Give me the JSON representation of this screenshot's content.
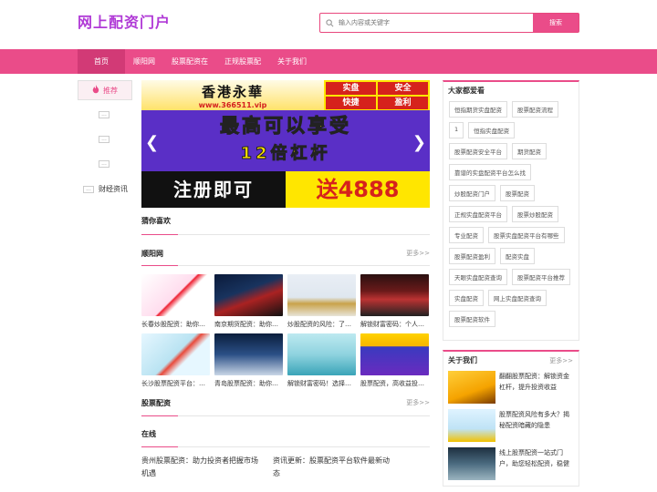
{
  "site": {
    "logo": "网上配资门户"
  },
  "search": {
    "placeholder": "输入内容或关键字",
    "button": "搜索"
  },
  "nav": {
    "items": [
      "首页",
      "顺阳网",
      "股票配资在",
      "正规股票配",
      "关于我们"
    ]
  },
  "left": {
    "recommend": "推荐",
    "dots": [
      "...",
      "...",
      "...",
      "..."
    ],
    "category": "财经资讯"
  },
  "banner": {
    "brand": "香港永華",
    "url": "www.366511.vip",
    "tags": [
      "实盘",
      "安全",
      "快捷",
      "盈利"
    ],
    "line1": "最高可以享受",
    "line2": "12倍杠杆",
    "line3a": "注册即可",
    "line3b": "送4888"
  },
  "sections": {
    "guess": "猜你喜欢",
    "shunyang": "顺阳网",
    "peizi": "股票配资",
    "online": "在线",
    "more": "更多>>"
  },
  "thumbs": [
    {
      "caption": "长春炒股配资：助你…"
    },
    {
      "caption": "南京期货配资：助你…"
    },
    {
      "caption": "炒股配资的风险：了…"
    },
    {
      "caption": "解锁财富密码：个人…"
    },
    {
      "caption": "长沙股票配资平台：…"
    },
    {
      "caption": "青岛股票配资：助你…"
    },
    {
      "caption": "解锁财富密码！选择…"
    },
    {
      "caption": "股票配资，高收益投…"
    }
  ],
  "online": [
    "贵州股票配资：助力投资者把握市场机遇",
    "资讯更新：股票配资平台软件最新动态"
  ],
  "hot": {
    "title": "大家都爱看",
    "tags": [
      "恒指期货实盘配资",
      "股票配资流程",
      "1",
      "恒指实盘配资",
      "股票配资安全平台",
      "期货配资",
      "靠谱的实盘配资平台怎么找",
      "炒股配资门户",
      "股票配资",
      "正规实盘配资平台",
      "股票炒股配资",
      "专业配资",
      "股票实盘配资平台有哪些",
      "股票配资盈利",
      "配资实盘",
      "天眼实盘配资查询",
      "股票配资平台推荐",
      "实盘配资",
      "网上实盘配资查询",
      "股票配资软件"
    ]
  },
  "about": {
    "title": "关于我们",
    "more": "更多>>",
    "items": [
      "翻翻股票配资：解锁资金杠杆，提升投资收益",
      "股票配资风险有多大？揭秘配资暗藏的隐患",
      "线上股票配资一站式门户，助您轻松配资，稳健"
    ]
  }
}
